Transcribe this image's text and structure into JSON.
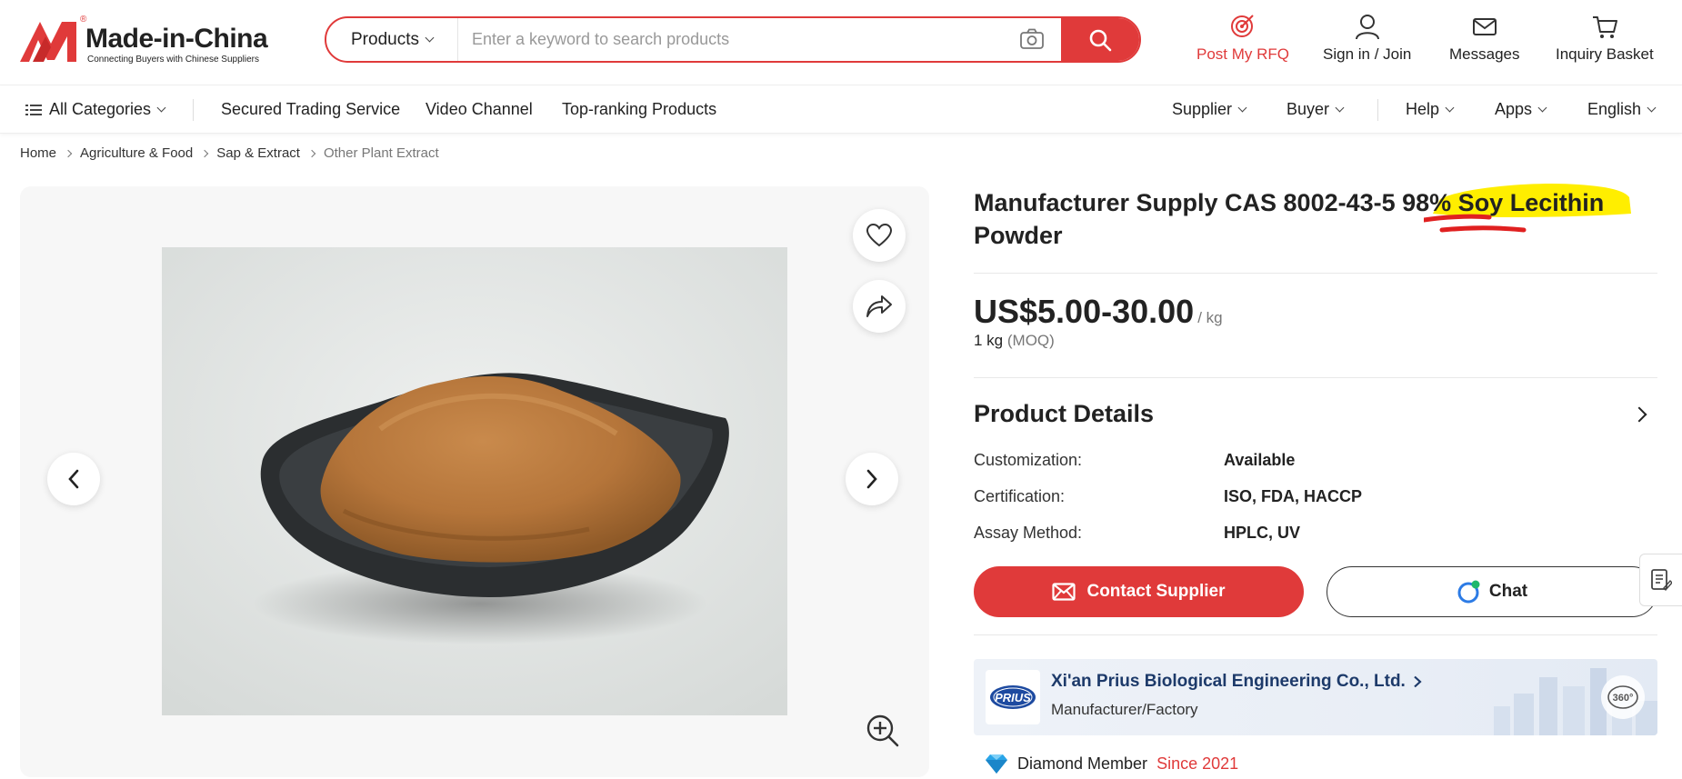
{
  "header": {
    "logo": {
      "brand": "Made-in-China",
      "tagline": "Connecting Buyers with Chinese Suppliers",
      "reg_mark": "®"
    },
    "search": {
      "category": "Products",
      "placeholder": "Enter a keyword to search products"
    },
    "actions": {
      "rfq": "Post My RFQ",
      "sign_in": "Sign in / Join",
      "messages": "Messages",
      "basket": "Inquiry Basket"
    }
  },
  "nav": {
    "all_categories": "All Categories",
    "links": [
      "Secured Trading Service",
      "Video Channel",
      "Top-ranking Products"
    ],
    "right": [
      "Supplier",
      "Buyer",
      "Help",
      "Apps",
      "English"
    ]
  },
  "breadcrumb": [
    "Home",
    "Agriculture & Food",
    "Sap & Extract",
    "Other Plant Extract"
  ],
  "product": {
    "title_line1": "Manufacturer Supply CAS 8002-43-5 98% Soy Lecithin",
    "title_line2": "Powder",
    "price": "US$5.00-30.00",
    "price_unit": "/ kg",
    "moq_qty": "1 kg",
    "moq_label": "(MOQ)"
  },
  "details": {
    "heading": "Product Details",
    "specs": [
      {
        "key": "Customization:",
        "value": "Available"
      },
      {
        "key": "Certification:",
        "value": "ISO, FDA, HACCP"
      },
      {
        "key": "Assay Method:",
        "value": "HPLC, UV"
      }
    ]
  },
  "buttons": {
    "contact": "Contact Supplier",
    "chat": "Chat"
  },
  "supplier": {
    "name": "Xi'an Prius Biological Engineering Co., Ltd.",
    "type": "Manufacturer/Factory",
    "logo_text": "PRIUS",
    "vr_label": "360°"
  },
  "membership": {
    "level": "Diamond Member",
    "since": "Since 2021"
  },
  "colors": {
    "brand_red": "#e03a3a",
    "highlight_yellow": "#ffee00",
    "supplier_blue": "#1d3a6a"
  },
  "icons": [
    "camera-icon",
    "search-icon",
    "rfq-target-icon",
    "user-icon",
    "mail-icon",
    "cart-icon",
    "menu-list-icon",
    "heart-icon",
    "share-icon",
    "chevron-left-icon",
    "chevron-right-icon",
    "zoom-in-icon",
    "envelope-icon",
    "chat-bubble-icon",
    "notes-icon",
    "vr-360-icon",
    "diamond-icon"
  ]
}
